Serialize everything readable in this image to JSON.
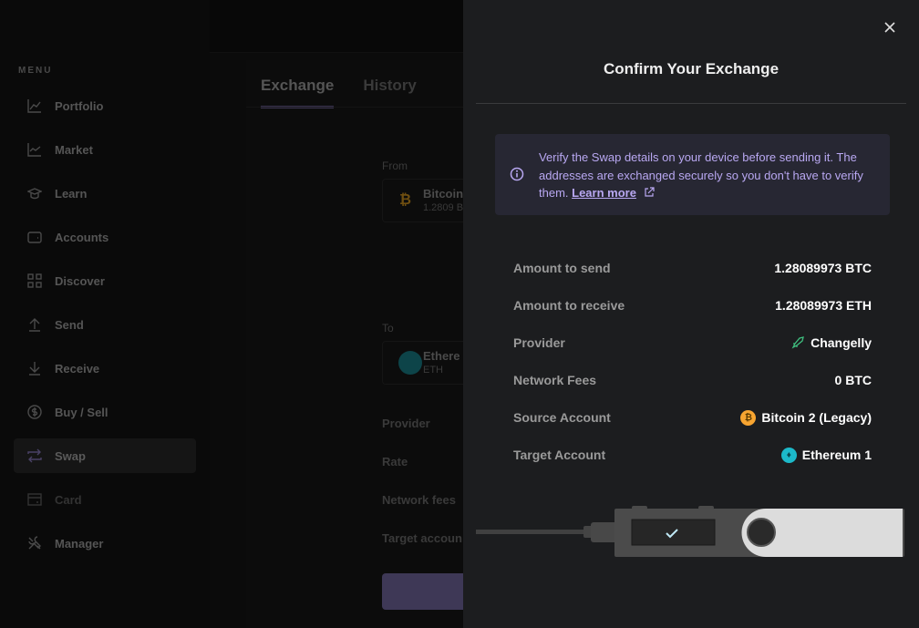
{
  "sidebar": {
    "title": "MENU",
    "items": [
      {
        "label": "Portfolio",
        "icon": "chart-line-icon"
      },
      {
        "label": "Market",
        "icon": "market-icon"
      },
      {
        "label": "Learn",
        "icon": "graduation-cap-icon"
      },
      {
        "label": "Accounts",
        "icon": "wallet-icon"
      },
      {
        "label": "Discover",
        "icon": "grid-icon"
      },
      {
        "label": "Send",
        "icon": "arrow-up-icon"
      },
      {
        "label": "Receive",
        "icon": "arrow-down-icon"
      },
      {
        "label": "Buy / Sell",
        "icon": "dollar-icon"
      },
      {
        "label": "Swap",
        "icon": "swap-icon",
        "active": true
      },
      {
        "label": "Card",
        "icon": "card-icon",
        "disabled": true
      },
      {
        "label": "Manager",
        "icon": "tools-icon"
      }
    ]
  },
  "main": {
    "tabs": [
      "Exchange",
      "History"
    ],
    "from_label": "From",
    "from_name": "Bitcoin",
    "from_sub": "1.2809 B",
    "to_label": "To",
    "to_name": "Ethere",
    "to_sub": "ETH",
    "rows": [
      "Provider",
      "Rate",
      "Network fees",
      "Target accoun"
    ]
  },
  "panel": {
    "title": "Confirm Your Exchange",
    "alert": {
      "text": "Verify the Swap details on your device before sending it. The addresses are exchanged securely so you don't have to verify them. ",
      "link": "Learn more"
    },
    "rows": [
      {
        "label": "Amount to send",
        "value": "1.28089973 BTC"
      },
      {
        "label": "Amount to receive",
        "value": "1.28089973 ETH"
      },
      {
        "label": "Provider",
        "value": "Changelly",
        "icon": "rocket-icon"
      },
      {
        "label": "Network Fees",
        "value": "0 BTC"
      },
      {
        "label": "Source Account",
        "value": "Bitcoin 2 (Legacy)",
        "icon": "bitcoin-icon"
      },
      {
        "label": "Target Account",
        "value": "Ethereum 1",
        "icon": "ethereum-icon"
      }
    ]
  },
  "colors": {
    "accent": "#b9a8f2",
    "bitcoin": "#f7a531",
    "ethereum": "#1cb9c9",
    "changelly": "#3fbf7f"
  }
}
